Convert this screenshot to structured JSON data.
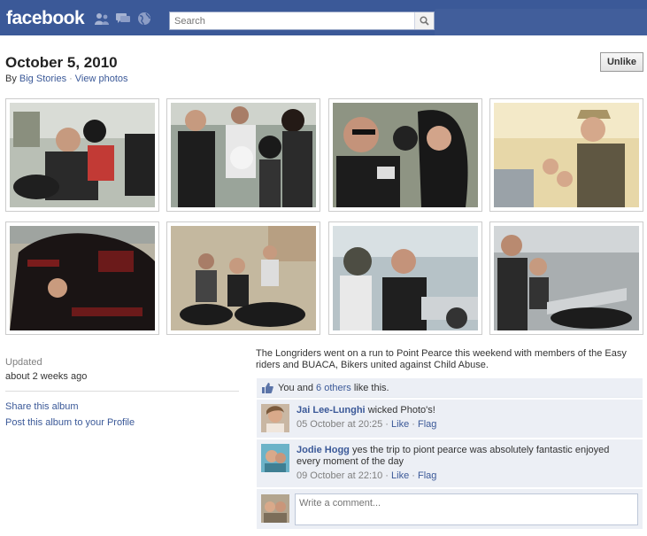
{
  "header": {
    "logo": "facebook",
    "search_placeholder": "Search"
  },
  "album": {
    "title": "October 5, 2010",
    "by_prefix": "By",
    "author": "Big Stories",
    "separator": "·",
    "view_photos": "View photos",
    "unlike_label": "Unlike",
    "description": "The Longriders went on a run to Point Pearce this weekend with members of the Easy riders and BUACA, Bikers united against Child Abuse."
  },
  "sidebar": {
    "updated_label": "Updated",
    "updated_value": "about 2 weeks ago",
    "share_label": "Share this album",
    "post_label": "Post this album to your Profile"
  },
  "likes": {
    "prefix": "You and ",
    "others_link": "6 others",
    "suffix": " like this."
  },
  "comments": [
    {
      "author": "Jai Lee-Lunghi",
      "text": "wicked Photo's!",
      "time": "05 October at 20:25",
      "sep": "·",
      "like": "Like",
      "flag": "Flag"
    },
    {
      "author": "Jodie Hogg",
      "text": "yes the trip to piont pearce was absolutely fantastic enjoyed every moment of the day",
      "time": "09 October at 22:10",
      "sep": "·",
      "like": "Like",
      "flag": "Flag"
    }
  ],
  "compose": {
    "placeholder": "Write a comment..."
  },
  "colors": {
    "brand": "#3b5998",
    "panel": "#eceff5"
  }
}
